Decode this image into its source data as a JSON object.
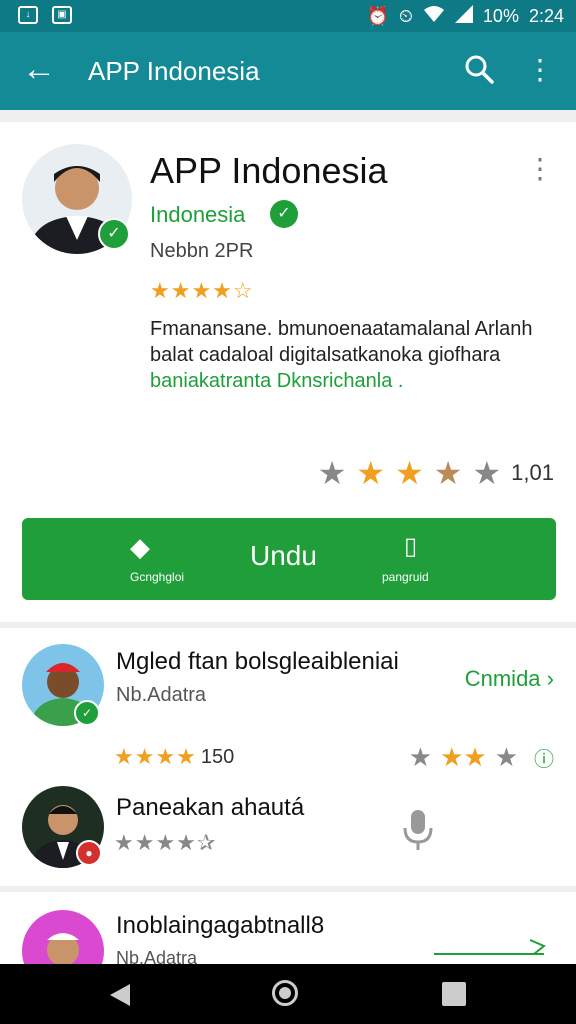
{
  "status": {
    "battery": "10%",
    "time": "2:24"
  },
  "appbar": {
    "title": "APP Indonesia"
  },
  "app": {
    "name": "APP Indonesia",
    "developer": "Indonesia",
    "version": "Nebbn 2PR",
    "stars_text": "★★★★☆",
    "desc_line1": "Fmanansane. bmunoenaatamalanal Arlanh",
    "desc_line2": "balat cadaloal digitalsatkanoka giofhara",
    "desc_line3": "baniakatranta Dknsrichanla .",
    "rating_count": "1,01",
    "install": {
      "left_label": "Gcnghgloi",
      "main_label": "Undu",
      "right_label": "pangruid"
    }
  },
  "reviews": [
    {
      "title": "Mgled ftan bolsgleaibleniai",
      "sub": "Nb.Adatra",
      "action": "Cnmida",
      "count": "150"
    },
    {
      "title": "Paneakan ahautá",
      "stars": "★★★★✰"
    },
    {
      "title": "Inoblaingagabtnall8",
      "sub": "Nb.Adatra"
    }
  ],
  "colors": {
    "primary": "#138a96",
    "install": "#1f9e3a",
    "star": "#f0a020"
  }
}
